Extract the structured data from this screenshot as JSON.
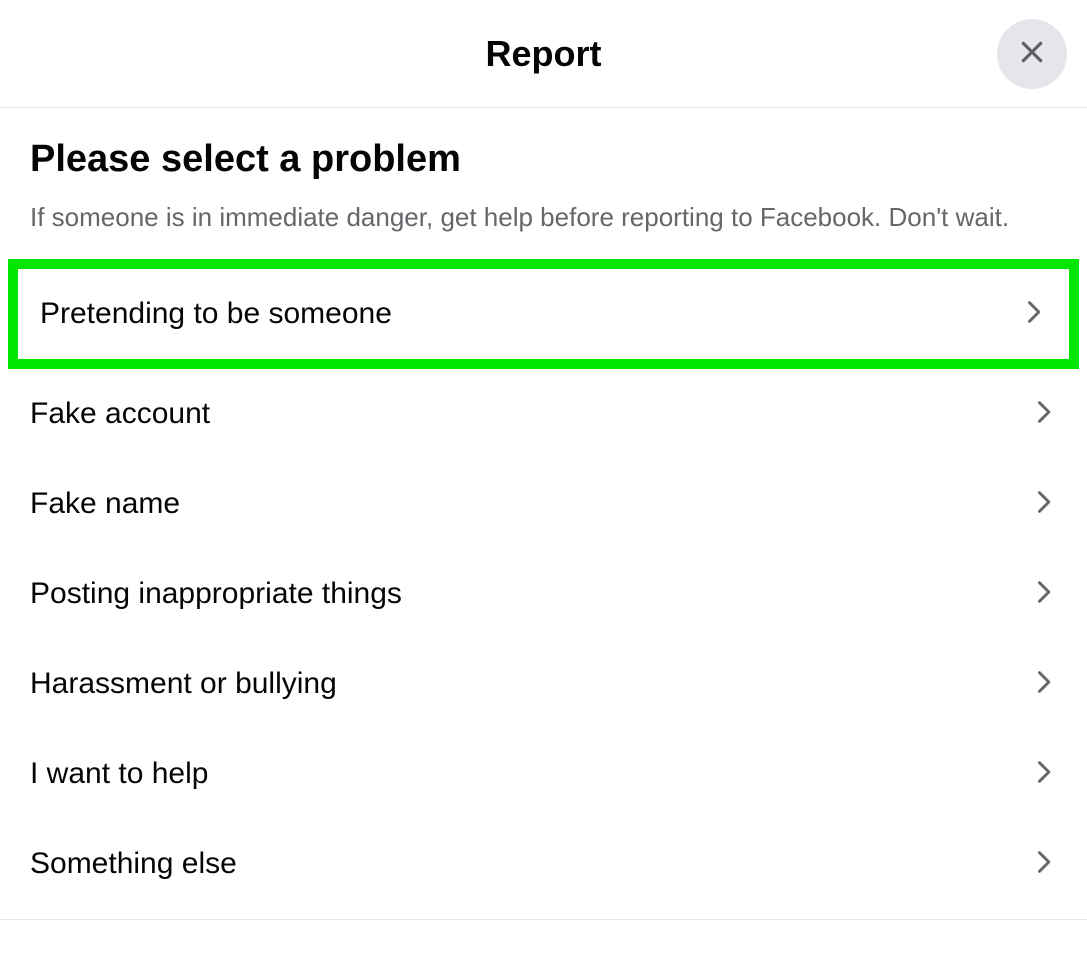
{
  "header": {
    "title": "Report"
  },
  "content": {
    "subtitle": "Please select a problem",
    "description": "If someone is in immediate danger, get help before reporting to Facebook. Don't wait."
  },
  "options": [
    {
      "label": "Pretending to be someone",
      "highlighted": true
    },
    {
      "label": "Fake account",
      "highlighted": false
    },
    {
      "label": "Fake name",
      "highlighted": false
    },
    {
      "label": "Posting inappropriate things",
      "highlighted": false
    },
    {
      "label": "Harassment or bullying",
      "highlighted": false
    },
    {
      "label": "I want to help",
      "highlighted": false
    },
    {
      "label": "Something else",
      "highlighted": false
    }
  ]
}
